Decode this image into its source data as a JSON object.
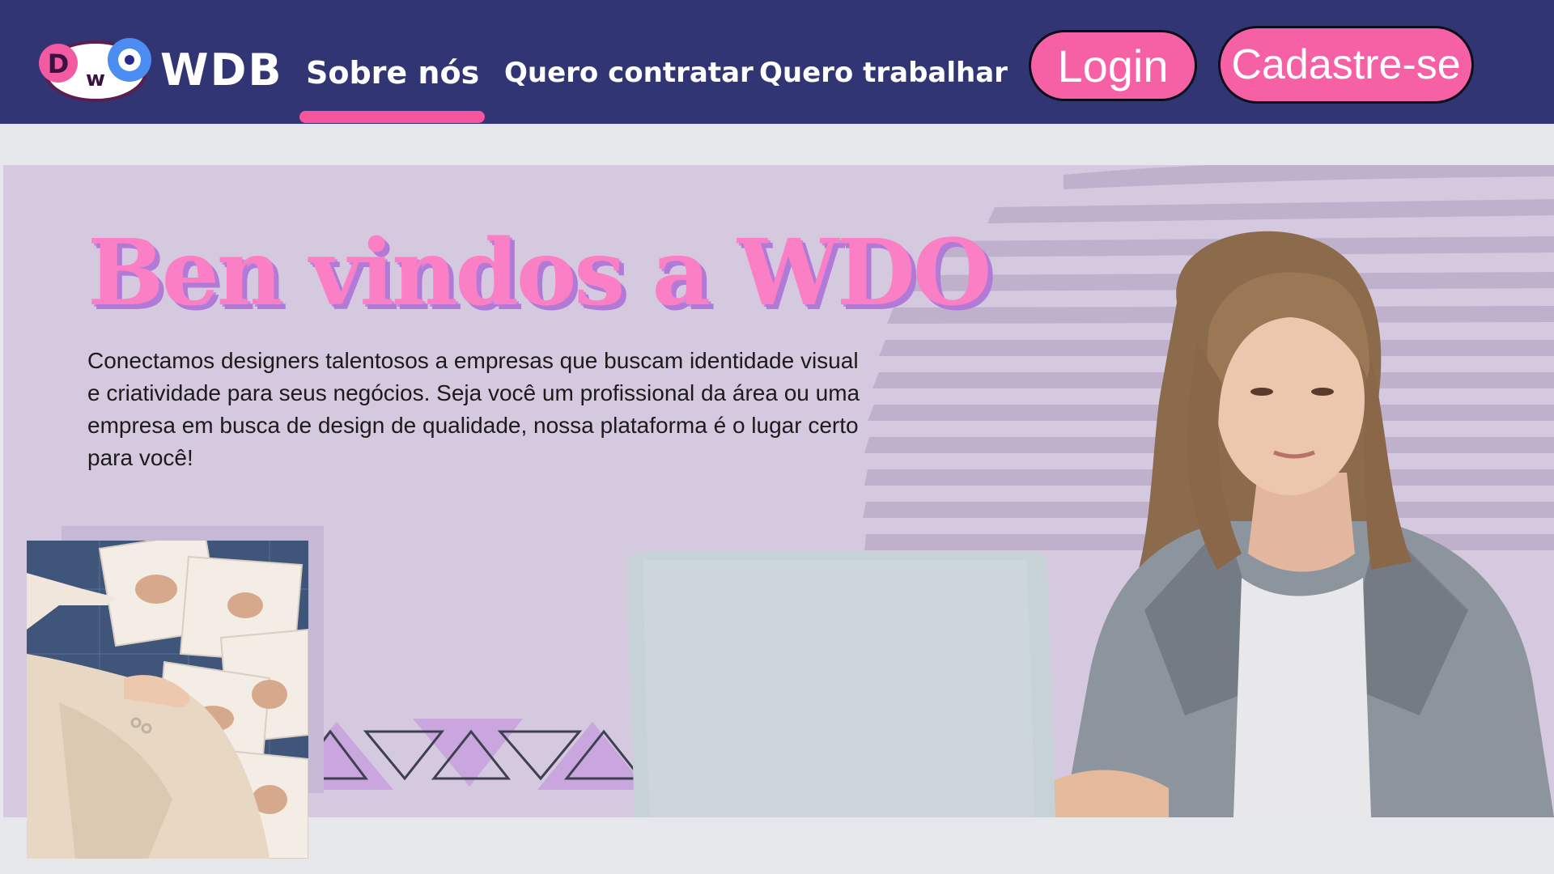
{
  "header": {
    "logo_icon": "dwo-mascot-logo",
    "brand": "WDB",
    "nav": {
      "sobre": "Sobre nós",
      "contratar": "Quero contratar",
      "trabalhar": "Quero trabalhar"
    },
    "login_label": "Login",
    "signup_label": "Cadastre-se"
  },
  "hero": {
    "title": "Ben vindos a WDO",
    "description": "Conectamos designers talentosos a empresas que buscam identidade visual e criatividade para seus negócios. Seja você um profissional da área ou uma empresa em busca de design de qualidade, nossa plataforma é o lugar certo para você!",
    "main_image": "woman-at-laptop-photo",
    "side_image": "fashion-design-sketches-photo"
  },
  "colors": {
    "navbar": "#313573",
    "accent_pink": "#f660a5",
    "hero_bg": "#d4c9df",
    "title_pink": "#fb7fc4",
    "title_shadow": "#b07ad6"
  }
}
